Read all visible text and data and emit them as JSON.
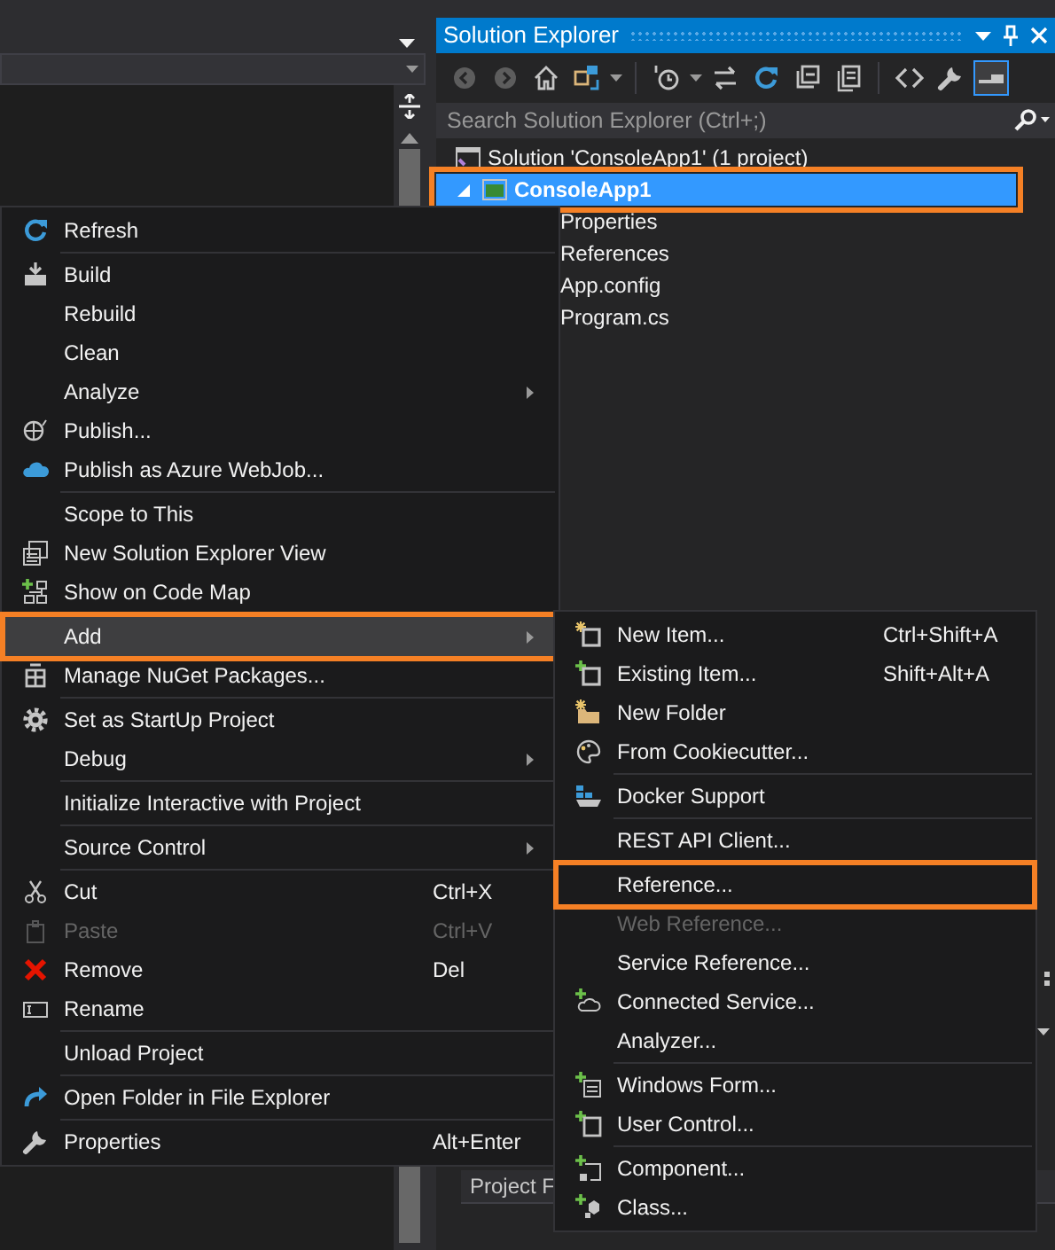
{
  "solution_explorer": {
    "title": "Solution Explorer",
    "toolbar": [
      {
        "disabled": true,
        "pressed": false
      },
      {
        "disabled": true,
        "pressed": false
      },
      {
        "disabled": false,
        "pressed": false
      },
      {
        "disabled": false,
        "pressed": false
      },
      {
        "disabled": false,
        "pressed": false
      },
      {
        "disabled": false,
        "pressed": false
      },
      {
        "disabled": false,
        "pressed": false
      },
      {
        "disabled": false,
        "pressed": false
      },
      {
        "disabled": false,
        "pressed": false
      },
      {
        "disabled": false,
        "pressed": false
      },
      {
        "disabled": false,
        "pressed": false
      },
      {
        "disabled": false,
        "pressed": true
      }
    ],
    "search": {
      "placeholder": "Search Solution Explorer (Ctrl+;)"
    },
    "tree": [
      {
        "label": "Solution 'ConsoleApp1' (1 project)",
        "selected": false,
        "annotated": false,
        "children": [
          {
            "label": "ConsoleApp1",
            "selected": true,
            "annotated": true,
            "expanded": true,
            "children": [
              {
                "label": "Properties",
                "selected": false,
                "annotated": false
              },
              {
                "label": "References",
                "selected": false,
                "annotated": false
              },
              {
                "label": "App.config",
                "selected": false,
                "annotated": false
              },
              {
                "label": "Program.cs",
                "selected": false,
                "annotated": false
              }
            ]
          }
        ]
      }
    ]
  },
  "properties_panel": {
    "rows": [
      "Project F"
    ]
  },
  "context_menu": {
    "items": [
      {
        "kind": "item",
        "label": "Refresh",
        "submenu": false,
        "disabled": false,
        "selected": false,
        "annotated": false
      },
      {
        "kind": "separator"
      },
      {
        "kind": "item",
        "label": "Build",
        "submenu": false,
        "disabled": false,
        "selected": false,
        "annotated": false
      },
      {
        "kind": "item",
        "label": "Rebuild",
        "submenu": false,
        "disabled": false,
        "selected": false,
        "annotated": false
      },
      {
        "kind": "item",
        "label": "Clean",
        "submenu": false,
        "disabled": false,
        "selected": false,
        "annotated": false
      },
      {
        "kind": "item",
        "label": "Analyze",
        "submenu": true,
        "disabled": false,
        "selected": false,
        "annotated": false
      },
      {
        "kind": "item",
        "label": "Publish...",
        "submenu": false,
        "disabled": false,
        "selected": false,
        "annotated": false
      },
      {
        "kind": "item",
        "label": "Publish as Azure WebJob...",
        "submenu": false,
        "disabled": false,
        "selected": false,
        "annotated": false
      },
      {
        "kind": "separator"
      },
      {
        "kind": "item",
        "label": "Scope to This",
        "submenu": false,
        "disabled": false,
        "selected": false,
        "annotated": false
      },
      {
        "kind": "item",
        "label": "New Solution Explorer View",
        "submenu": false,
        "disabled": false,
        "selected": false,
        "annotated": false
      },
      {
        "kind": "item",
        "label": "Show on Code Map",
        "submenu": false,
        "disabled": false,
        "selected": false,
        "annotated": false
      },
      {
        "kind": "separator"
      },
      {
        "kind": "item",
        "label": "Add",
        "submenu": true,
        "disabled": false,
        "selected": true,
        "annotated": true
      },
      {
        "kind": "item",
        "label": "Manage NuGet Packages...",
        "submenu": false,
        "disabled": false,
        "selected": false,
        "annotated": false
      },
      {
        "kind": "separator"
      },
      {
        "kind": "item",
        "label": "Set as StartUp Project",
        "submenu": false,
        "disabled": false,
        "selected": false,
        "annotated": false
      },
      {
        "kind": "item",
        "label": "Debug",
        "submenu": true,
        "disabled": false,
        "selected": false,
        "annotated": false
      },
      {
        "kind": "separator"
      },
      {
        "kind": "item",
        "label": "Initialize Interactive with Project",
        "submenu": false,
        "disabled": false,
        "selected": false,
        "annotated": false
      },
      {
        "kind": "separator"
      },
      {
        "kind": "item",
        "label": "Source Control",
        "submenu": true,
        "disabled": false,
        "selected": false,
        "annotated": false
      },
      {
        "kind": "separator"
      },
      {
        "kind": "item",
        "label": "Cut",
        "shortcut": "Ctrl+X",
        "submenu": false,
        "disabled": false,
        "selected": false,
        "annotated": false
      },
      {
        "kind": "item",
        "label": "Paste",
        "shortcut": "Ctrl+V",
        "submenu": false,
        "disabled": true,
        "selected": false,
        "annotated": false
      },
      {
        "kind": "item",
        "label": "Remove",
        "shortcut": "Del",
        "submenu": false,
        "disabled": false,
        "selected": false,
        "annotated": false
      },
      {
        "kind": "item",
        "label": "Rename",
        "submenu": false,
        "disabled": false,
        "selected": false,
        "annotated": false
      },
      {
        "kind": "separator"
      },
      {
        "kind": "item",
        "label": "Unload Project",
        "submenu": false,
        "disabled": false,
        "selected": false,
        "annotated": false
      },
      {
        "kind": "separator"
      },
      {
        "kind": "item",
        "label": "Open Folder in File Explorer",
        "submenu": false,
        "disabled": false,
        "selected": false,
        "annotated": false
      },
      {
        "kind": "separator"
      },
      {
        "kind": "item",
        "label": "Properties",
        "shortcut": "Alt+Enter",
        "submenu": false,
        "disabled": false,
        "selected": false,
        "annotated": false
      }
    ]
  },
  "add_submenu": {
    "items": [
      {
        "kind": "item",
        "label": "New Item...",
        "shortcut": "Ctrl+Shift+A",
        "disabled": false,
        "selected": false,
        "annotated": false
      },
      {
        "kind": "item",
        "label": "Existing Item...",
        "shortcut": "Shift+Alt+A",
        "disabled": false,
        "selected": false,
        "annotated": false
      },
      {
        "kind": "item",
        "label": "New Folder",
        "disabled": false,
        "selected": false,
        "annotated": false
      },
      {
        "kind": "item",
        "label": "From Cookiecutter...",
        "disabled": false,
        "selected": false,
        "annotated": false
      },
      {
        "kind": "separator"
      },
      {
        "kind": "item",
        "label": "Docker Support",
        "disabled": false,
        "selected": false,
        "annotated": false
      },
      {
        "kind": "separator"
      },
      {
        "kind": "item",
        "label": "REST API Client...",
        "disabled": false,
        "selected": false,
        "annotated": false
      },
      {
        "kind": "separator"
      },
      {
        "kind": "item",
        "label": "Reference...",
        "disabled": false,
        "selected": false,
        "annotated": true
      },
      {
        "kind": "item",
        "label": "Web Reference...",
        "disabled": true,
        "selected": false,
        "annotated": false
      },
      {
        "kind": "item",
        "label": "Service Reference...",
        "disabled": false,
        "selected": false,
        "annotated": false
      },
      {
        "kind": "item",
        "label": "Connected Service...",
        "disabled": false,
        "selected": false,
        "annotated": false
      },
      {
        "kind": "item",
        "label": "Analyzer...",
        "disabled": false,
        "selected": false,
        "annotated": false
      },
      {
        "kind": "separator"
      },
      {
        "kind": "item",
        "label": "Windows Form...",
        "disabled": false,
        "selected": false,
        "annotated": false
      },
      {
        "kind": "item",
        "label": "User Control...",
        "disabled": false,
        "selected": false,
        "annotated": false
      },
      {
        "kind": "separator"
      },
      {
        "kind": "item",
        "label": "Component...",
        "disabled": false,
        "selected": false,
        "annotated": false
      },
      {
        "kind": "item",
        "label": "Class...",
        "disabled": false,
        "selected": false,
        "annotated": false
      }
    ]
  }
}
